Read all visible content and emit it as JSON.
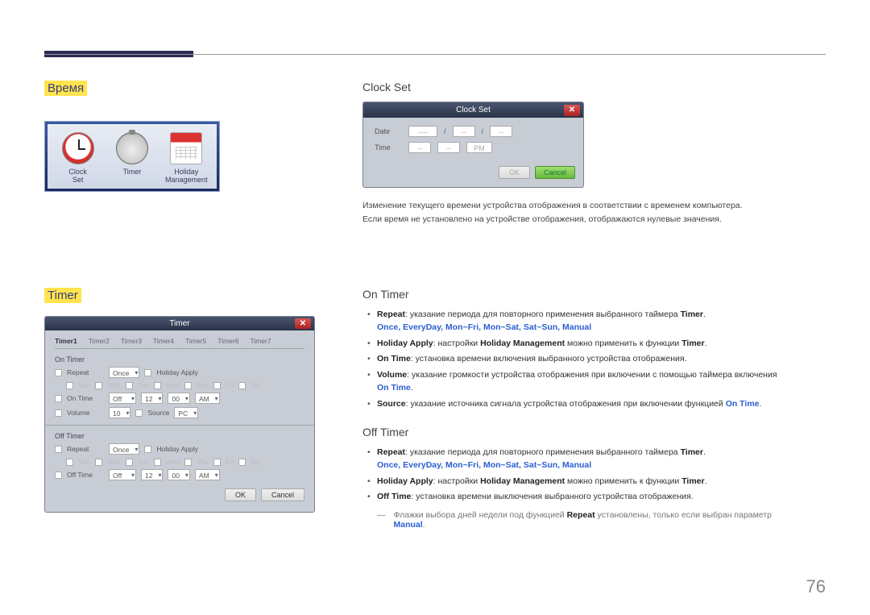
{
  "page_number": "76",
  "left": {
    "heading_time": "Время",
    "heading_timer": "Timer",
    "time_icons": {
      "clock_set": "Clock\nSet",
      "timer": "Timer",
      "holiday": "Holiday\nManagement"
    },
    "timer_dialog": {
      "title": "Timer",
      "tabs": [
        "Timer1",
        "Timer2",
        "Timer3",
        "Timer4",
        "Timer5",
        "Timer6",
        "Timer7"
      ],
      "on_timer_label": "On Timer",
      "off_timer_label": "Off Timer",
      "repeat_label": "Repeat",
      "repeat_value": "Once",
      "holiday_apply": "Holiday Apply",
      "days": [
        "Sun",
        "Mon",
        "Tue",
        "Wed",
        "Thu",
        "Fri",
        "Sat"
      ],
      "on_time_label": "On Time",
      "on_time_state": "Off",
      "on_time_h": "12",
      "on_time_m": "00",
      "on_time_ampm": "AM",
      "volume_label": "Volume",
      "volume_value": "10",
      "source_label": "Source",
      "source_value": "PC",
      "off_time_label": "Off Time",
      "off_time_state": "Off",
      "off_time_h": "12",
      "off_time_m": "00",
      "off_time_ampm": "AM",
      "ok": "OK",
      "cancel": "Cancel"
    }
  },
  "right": {
    "clock_set": {
      "heading": "Clock Set",
      "dialog_title": "Clock Set",
      "date_label": "Date",
      "time_label": "Time",
      "pm": "PM",
      "ok": "OK",
      "cancel": "Cancel",
      "dashes": "----",
      "short_dashes": "--",
      "slash": "/",
      "desc1": "Изменение текущего времени устройства отображения в соответствии с временем компьютера.",
      "desc2": "Если время не установлено на устройстве отображения, отображаются нулевые значения."
    },
    "on_timer": {
      "heading": "On Timer",
      "b1_pre": "Repeat",
      "b1_mid": ": указание периода для повторного применения выбранного таймера ",
      "b1_end": "Timer",
      "b1_options": "Once, EveryDay, Mon~Fri, Mon~Sat, Sat~Sun, Manual",
      "b2_pre": "Holiday Apply",
      "b2_mid": ": настройки ",
      "b2_hm": "Holiday Management",
      "b2_mid2": " можно применить к функции ",
      "b2_end": "Timer",
      "b3_pre": "On Time",
      "b3_text": ": установка времени включения выбранного устройства отображения.",
      "b4_pre": "Volume",
      "b4_text": ": указание громкости устройства отображения при включении с помощью таймера включения ",
      "b4_end": "On Time",
      "b5_pre": "Source",
      "b5_text": ": указание источника сигнала устройства отображения при включении функцией ",
      "b5_end": "On Time"
    },
    "off_timer": {
      "heading": "Off Timer",
      "b1_pre": "Repeat",
      "b1_mid": ": указание периода для повторного применения выбранного таймера ",
      "b1_end": "Timer",
      "b1_options": "Once, EveryDay, Mon~Fri, Mon~Sat, Sat~Sun, Manual",
      "b2_pre": "Holiday Apply",
      "b2_mid": ": настройки ",
      "b2_hm": "Holiday Management",
      "b2_mid2": " можно применить к функции ",
      "b2_end": "Timer",
      "b3_pre": "Off Time",
      "b3_text": ": установка времени выключения выбранного устройства отображения."
    },
    "note": {
      "dash": "―",
      "text1": "Флажки выбора дней недели под функцией ",
      "repeat": "Repeat",
      "text2": " установлены, только если выбран параметр ",
      "manual": "Manual",
      "period": "."
    }
  }
}
